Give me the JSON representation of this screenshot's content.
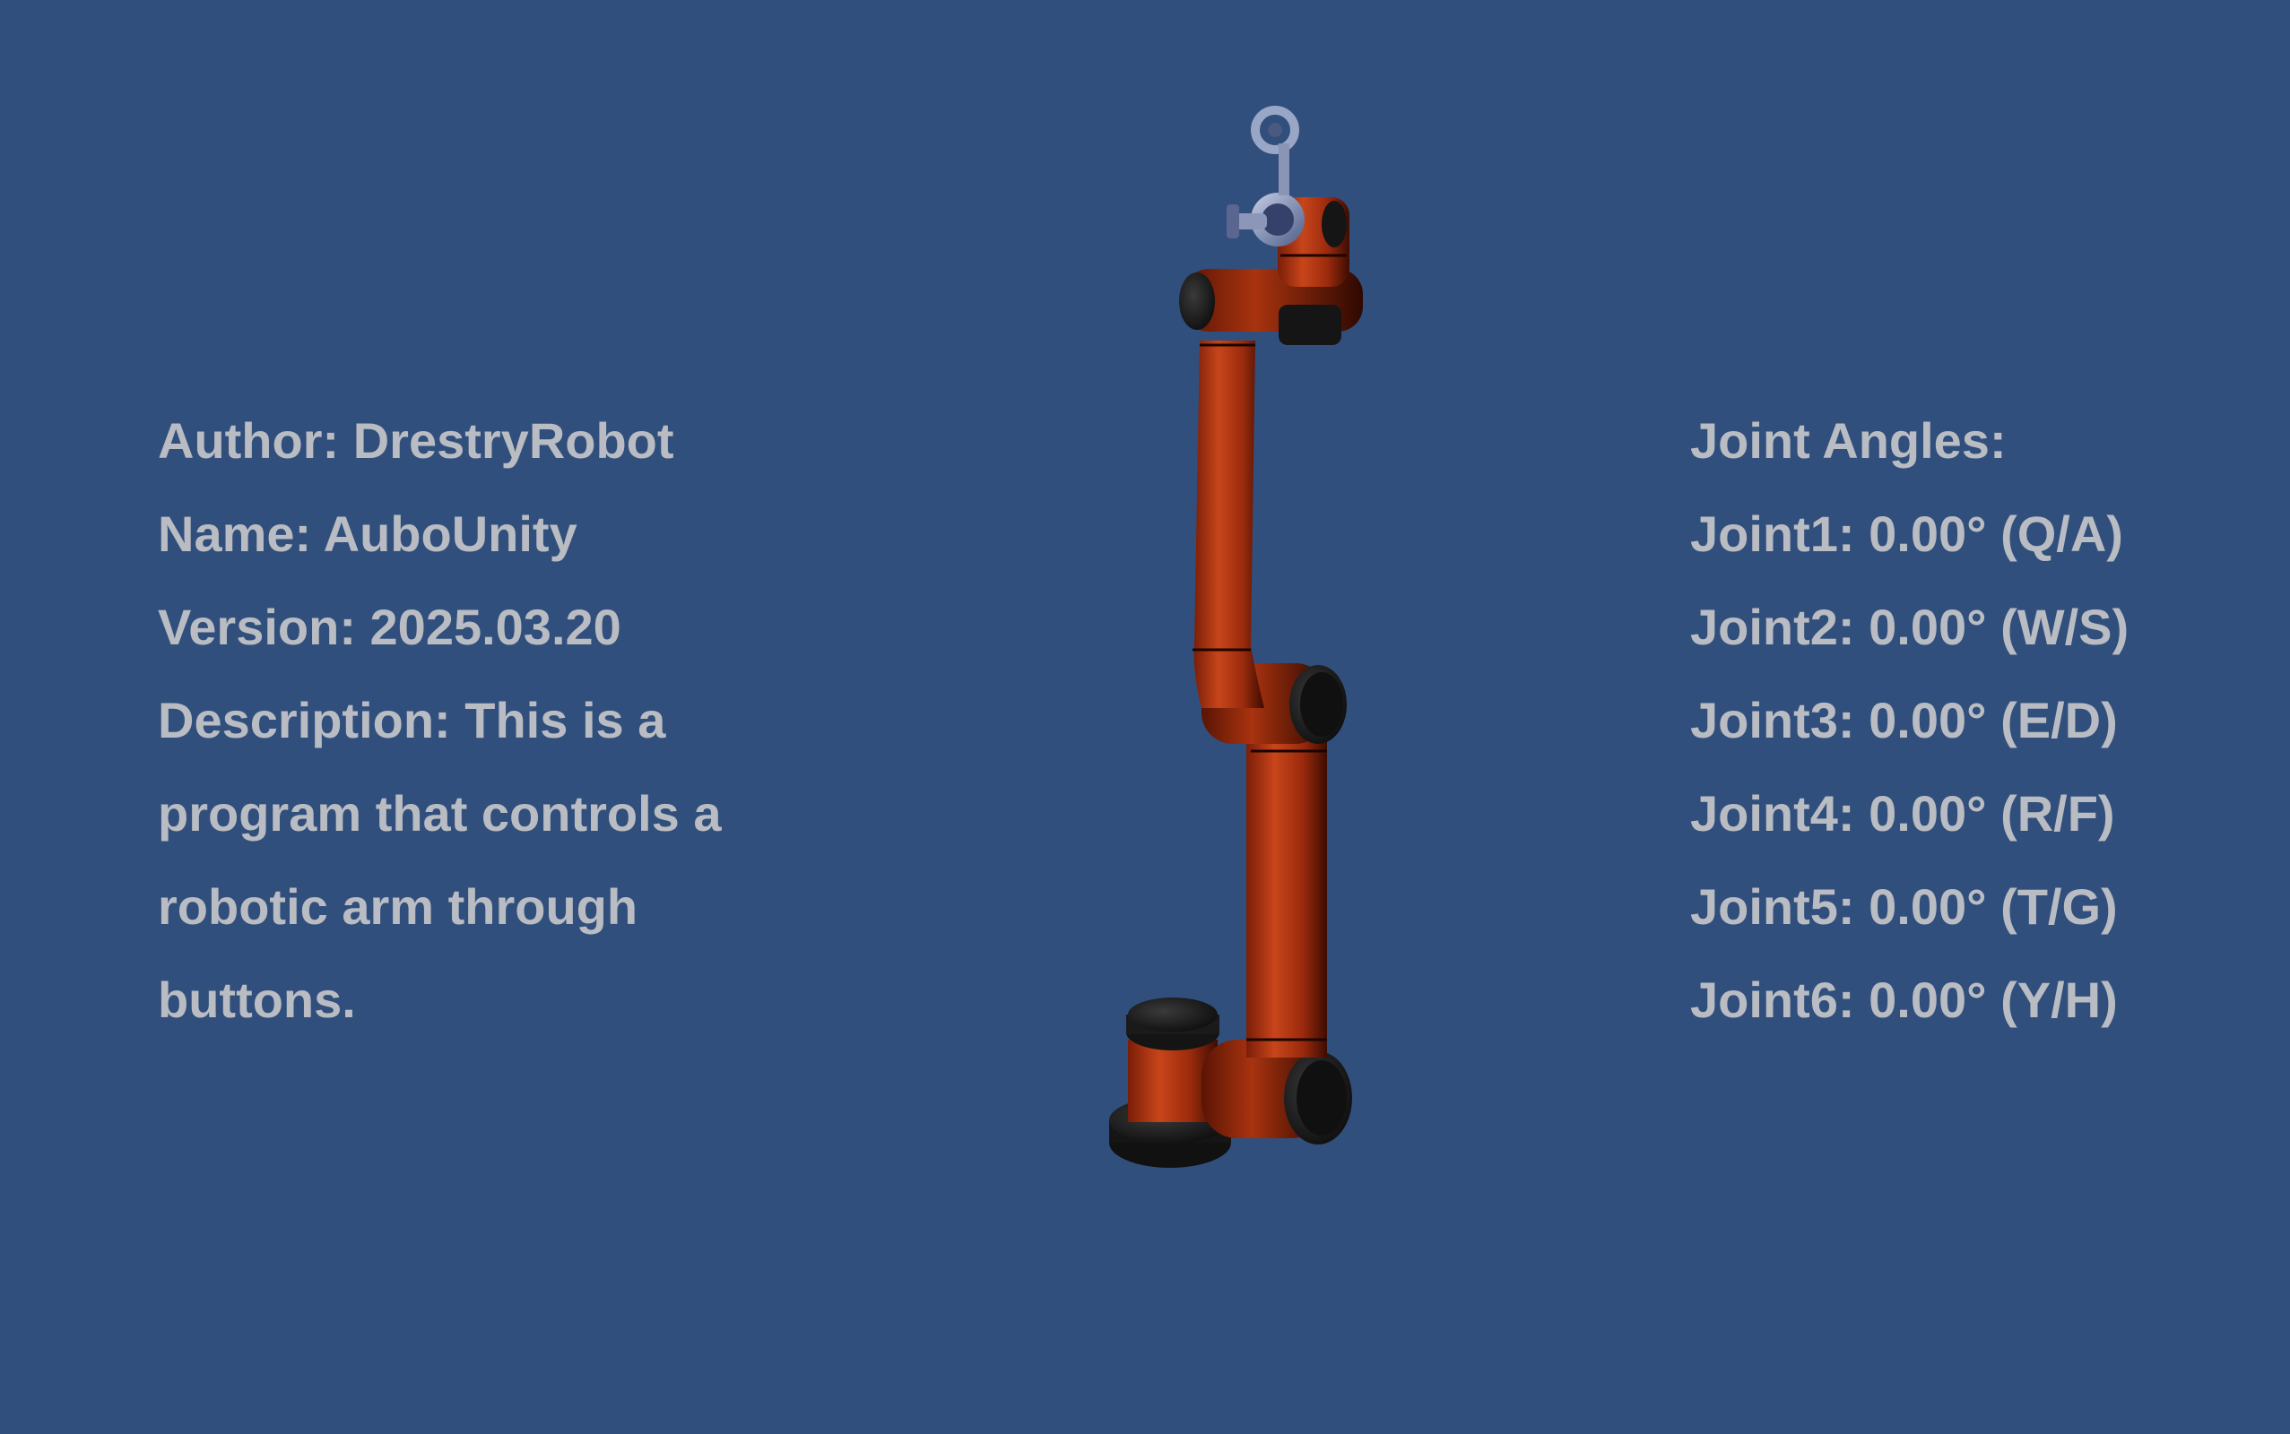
{
  "info": {
    "author": "Author: DrestryRobot",
    "name": "Name: AuboUnity",
    "version": "Version: 2025.03.20",
    "description": "Description: This is a program that controls a robotic arm through buttons."
  },
  "joints": {
    "title": "Joint Angles:",
    "items": [
      {
        "label": "Joint1: 0.00° (Q/A)"
      },
      {
        "label": "Joint2: 0.00° (W/S)"
      },
      {
        "label": "Joint3: 0.00° (E/D)"
      },
      {
        "label": "Joint4: 0.00° (R/F)"
      },
      {
        "label": "Joint5: 0.00° (T/G)"
      },
      {
        "label": "Joint6: 0.00° (Y/H)"
      }
    ]
  },
  "colors": {
    "background": "#314f7c",
    "text": "#b9bcc2",
    "arm": "#b83a14",
    "joint_cap": "#1b1b1b"
  }
}
